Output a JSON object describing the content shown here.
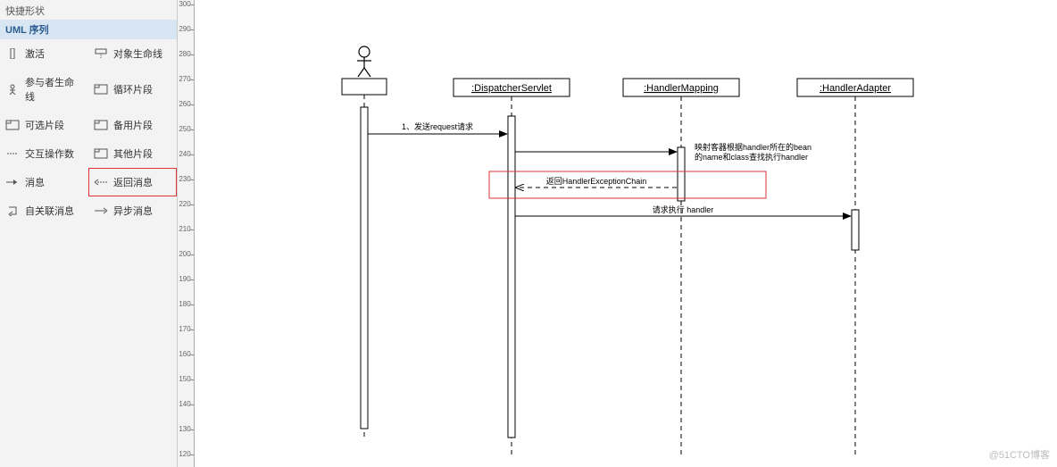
{
  "sidebar": {
    "title": "快捷形状",
    "section": "UML 序列",
    "items": [
      {
        "icon": "activation",
        "label": "激活"
      },
      {
        "icon": "lifeline-obj",
        "label": "对象生命线"
      },
      {
        "icon": "actor",
        "label": "参与者生命线"
      },
      {
        "icon": "loop",
        "label": "循环片段"
      },
      {
        "icon": "opt",
        "label": "可选片段"
      },
      {
        "icon": "alt",
        "label": "备用片段"
      },
      {
        "icon": "interaction",
        "label": "交互操作数"
      },
      {
        "icon": "other",
        "label": "其他片段"
      },
      {
        "icon": "msg",
        "label": "消息"
      },
      {
        "icon": "return",
        "label": "返回消息"
      },
      {
        "icon": "self",
        "label": "自关联消息"
      },
      {
        "icon": "async",
        "label": "异步消息"
      }
    ]
  },
  "ruler": {
    "ticks": [
      "300",
      "290",
      "280",
      "270",
      "260",
      "250",
      "240",
      "230",
      "220",
      "210",
      "200",
      "190",
      "180",
      "170",
      "160",
      "150",
      "140",
      "130",
      "120"
    ]
  },
  "diagram": {
    "lifelines": [
      {
        "name": ":DispatcherServlet"
      },
      {
        "name": ":HandlerMapping"
      },
      {
        "name": ":HandlerAdapter"
      }
    ],
    "messages": [
      {
        "label": "1、发送request请求"
      },
      {
        "label": "映射客器根据handler所在的bean的name和class查找执行handler"
      },
      {
        "label": "返回HandlerExceptionChain"
      },
      {
        "label": "请求执行 handler"
      }
    ]
  },
  "watermark": "@51CTO博客"
}
